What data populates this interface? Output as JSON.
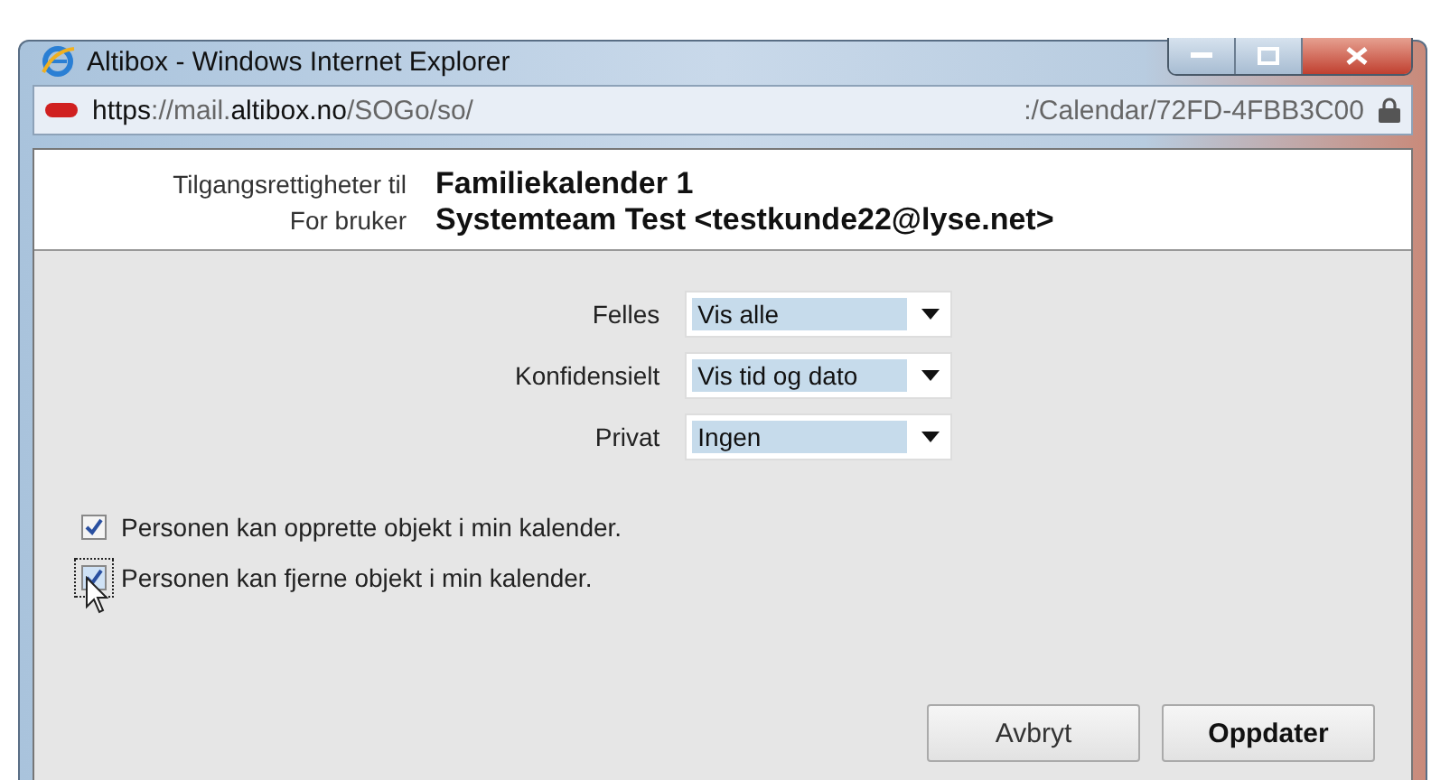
{
  "window": {
    "title": "Altibox - Windows Internet Explorer"
  },
  "address_bar": {
    "parts": [
      {
        "text": "https",
        "strong": true
      },
      {
        "text": "://mail.",
        "strong": false
      },
      {
        "text": "altibox.no",
        "strong": true
      },
      {
        "text": "/SOGo/so/",
        "strong": false
      }
    ],
    "end": ":/Calendar/72FD-4FBB3C00"
  },
  "header": {
    "rows": [
      {
        "label": "Tilgangsrettigheter til",
        "value": "Familiekalender 1"
      },
      {
        "label": "For bruker",
        "value": "Systemteam Test <testkunde22@lyse.net>"
      }
    ]
  },
  "selects": [
    {
      "label": "Felles",
      "value": "Vis alle"
    },
    {
      "label": "Konfidensielt",
      "value": "Vis tid og dato"
    },
    {
      "label": "Privat",
      "value": "Ingen"
    }
  ],
  "checkboxes": [
    {
      "label": "Personen kan opprette objekt i min kalender.",
      "checked": true,
      "focused": false
    },
    {
      "label": "Personen kan fjerne objekt i min kalender.",
      "checked": true,
      "focused": true
    }
  ],
  "buttons": [
    {
      "label": "Avbryt",
      "primary": false
    },
    {
      "label": "Oppdater",
      "primary": true
    }
  ]
}
